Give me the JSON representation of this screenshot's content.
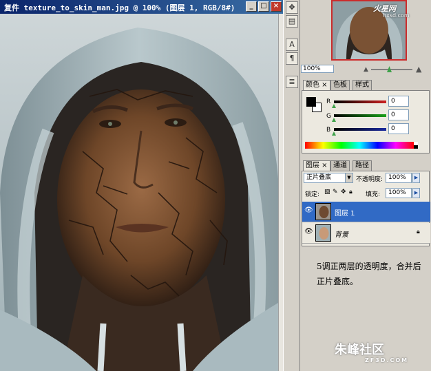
{
  "document": {
    "title": "复件 texture_to_skin_man.jpg @ 100% (图层 1, RGB/8#)",
    "controls": {
      "minimize": "_",
      "maximize": "□",
      "close": "×"
    }
  },
  "tools": [
    "move-icon",
    "stamp-icon",
    "type-icon",
    "paragraph-icon",
    "notes-icon"
  ],
  "navigator": {
    "zoom": "100%",
    "logo": "火星网",
    "logo_sub": "hxsd.com"
  },
  "color_panel": {
    "tabs": [
      "颜色",
      "色板",
      "样式"
    ],
    "channels": [
      {
        "label": "R",
        "value": "0",
        "color": "#cc2020"
      },
      {
        "label": "G",
        "value": "0",
        "color": "#1aa01a"
      },
      {
        "label": "B",
        "value": "0",
        "color": "#1a2aa0"
      }
    ],
    "foreground": "#000000",
    "background": "#ffffff"
  },
  "layers_panel": {
    "tabs": [
      "图层",
      "通道",
      "路径"
    ],
    "blend_mode": "正片叠底",
    "opacity_label": "不透明度:",
    "opacity": "100%",
    "lock_label": "锁定:",
    "fill_label": "填充:",
    "fill": "100%",
    "layers": [
      {
        "name": "图层 1",
        "selected": true
      },
      {
        "name": "背景",
        "selected": false,
        "locked": true
      }
    ]
  },
  "note": "5调正两层的透明度，合并后正片叠底。",
  "watermark": {
    "main": "朱峰社区",
    "sub": "ZF3D.COM"
  }
}
